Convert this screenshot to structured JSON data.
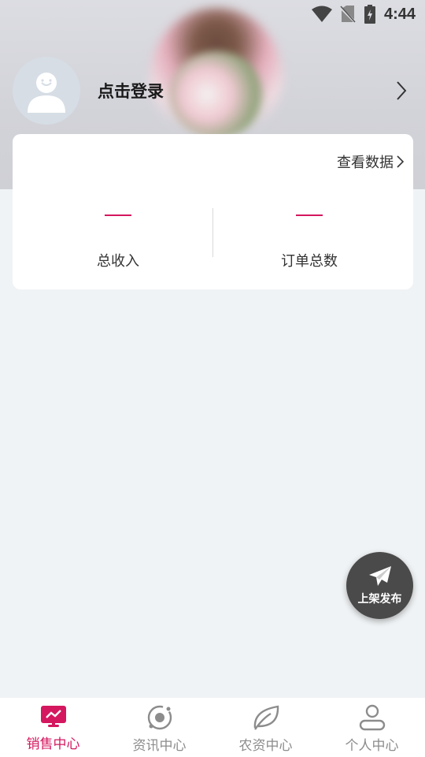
{
  "status_bar": {
    "time": "4:44"
  },
  "header": {
    "login_text": "点击登录"
  },
  "stats_card": {
    "view_data_label": "查看数据",
    "items": [
      {
        "value": "——",
        "label": "总收入"
      },
      {
        "value": "——",
        "label": "订单总数"
      }
    ]
  },
  "fab": {
    "label": "上架发布"
  },
  "bottom_nav": {
    "items": [
      {
        "label": "销售中心",
        "icon": "monitor-chart-icon",
        "active": true
      },
      {
        "label": "资讯中心",
        "icon": "orbit-icon",
        "active": false
      },
      {
        "label": "农资中心",
        "icon": "leaf-icon",
        "active": false
      },
      {
        "label": "个人中心",
        "icon": "user-icon",
        "active": false
      }
    ]
  },
  "colors": {
    "accent": "#d4175f",
    "inactive": "#8c8c8c",
    "fab": "#4a4a4a"
  }
}
